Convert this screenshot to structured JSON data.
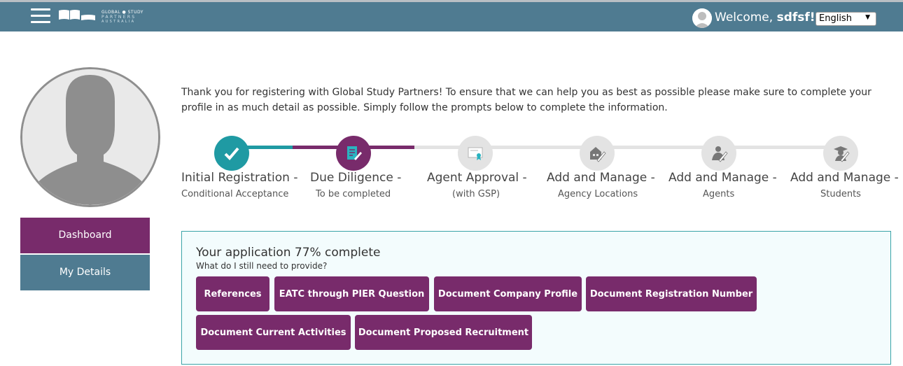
{
  "header": {
    "logo_line1": "GLOBAL ● STUDY",
    "logo_line2": "PARTNERS",
    "logo_line3": "AUSTRALIA",
    "welcome_prefix": "Welcome, ",
    "username": "sdfsf!",
    "language": "English"
  },
  "sidebar": {
    "dashboard_label": "Dashboard",
    "details_label": "My Details"
  },
  "intro_text": "Thank you for registering with Global Study Partners! To ensure that we can help you as best as possible please make sure to complete your profile in as much detail as possible. Simply follow the prompts below to complete the information.",
  "steps": [
    {
      "label": "Initial Registration -",
      "sub": "Conditional Acceptance",
      "state": "complete",
      "icon": "check-icon"
    },
    {
      "label": "Due Diligence -",
      "sub": "To be completed",
      "state": "current",
      "icon": "document-edit-icon"
    },
    {
      "label": "Agent Approval -",
      "sub": "(with GSP)",
      "state": "pending",
      "icon": "certificate-icon"
    },
    {
      "label": "Add and Manage -",
      "sub": "Agency Locations",
      "state": "pending",
      "icon": "building-edit-icon"
    },
    {
      "label": "Add and Manage -",
      "sub": "Agents",
      "state": "pending",
      "icon": "agent-edit-icon"
    },
    {
      "label": "Add and Manage -",
      "sub": "Students",
      "state": "pending",
      "icon": "graduate-edit-icon"
    }
  ],
  "application": {
    "title": "Your application 77% complete",
    "subtitle": "What do I still need to provide?",
    "percent_complete": 77,
    "items": [
      "References",
      "EATC through PIER Question",
      "Document Company Profile",
      "Document Registration Number",
      "Document Current Activities",
      "Document Proposed Recruitment"
    ]
  },
  "colors": {
    "header": "#4f7b91",
    "accent_purple": "#782b6b",
    "accent_teal": "#1f9aa3",
    "pending_gray": "#e3e3e3"
  }
}
